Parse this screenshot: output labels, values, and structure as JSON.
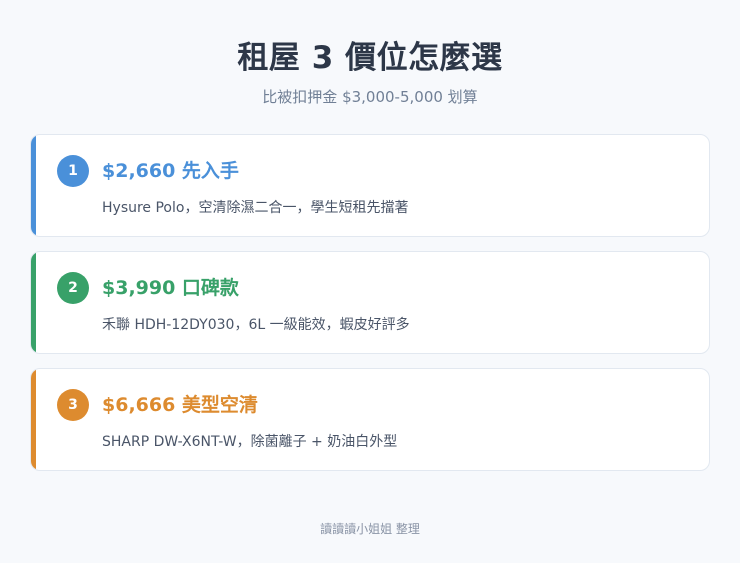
{
  "header": {
    "title": "租屋 3 價位怎麼選",
    "subtitle": "比被扣押金 $3,000-5,000 划算"
  },
  "cards": [
    {
      "number": "1",
      "title": "$2,660 先入手",
      "description": "Hysure Polo，空清除濕二合一，學生短租先擋著",
      "accent_color": "#4a90d9"
    },
    {
      "number": "2",
      "title": "$3,990 口碑款",
      "description": "禾聯 HDH-12DY030，6L 一級能效，蝦皮好評多",
      "accent_color": "#38a169"
    },
    {
      "number": "3",
      "title": "$6,666 美型空清",
      "description": "SHARP DW-X6NT-W，除菌離子 + 奶油白外型",
      "accent_color": "#dd8b2f"
    }
  ],
  "footer": {
    "credit": "讀讀讀小姐姐 整理"
  }
}
